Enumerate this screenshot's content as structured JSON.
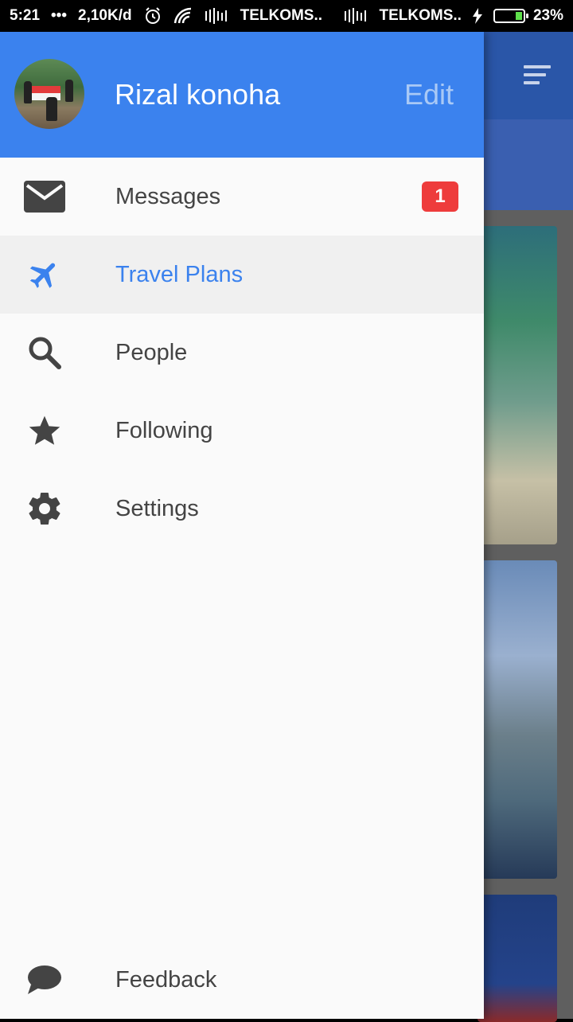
{
  "status_bar": {
    "time": "5:21",
    "dots": "•••",
    "speed": "2,10K/d",
    "carrier1": "TELKOMS..",
    "carrier2": "TELKOMS..",
    "battery": "23%"
  },
  "drawer": {
    "user_name": "Rizal konoha",
    "edit_label": "Edit",
    "items": [
      {
        "label": "Messages",
        "icon": "mail-icon",
        "badge": "1"
      },
      {
        "label": "Travel Plans",
        "icon": "airplane-icon",
        "active": true
      },
      {
        "label": "People",
        "icon": "search-icon"
      },
      {
        "label": "Following",
        "icon": "star-icon"
      },
      {
        "label": "Settings",
        "icon": "gear-icon"
      }
    ],
    "feedback_label": "Feedback",
    "colors": {
      "header": "#3b82ee",
      "active_text": "#3b82ee",
      "badge": "#ee3c3c"
    }
  }
}
